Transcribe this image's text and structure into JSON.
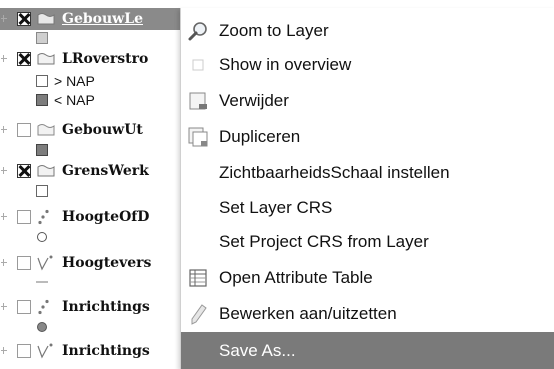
{
  "layer_tree": {
    "layers": [
      {
        "name": "GebouwLe",
        "checked": true,
        "icon": "polygon-layer-icon",
        "highlighted": true
      },
      {
        "name": "LRoverstro",
        "checked": true,
        "icon": "polygon-layer-icon"
      },
      {
        "name": "GebouwUt",
        "checked": false,
        "icon": "polygon-layer-icon"
      },
      {
        "name": "GrensWerk",
        "checked": true,
        "icon": "polygon-layer-icon"
      },
      {
        "name": "HoogteOfD",
        "checked": false,
        "icon": "point-layer-icon"
      },
      {
        "name": "Hoogtevers",
        "checked": false,
        "icon": "line-layer-icon"
      },
      {
        "name": "Inrichtings",
        "checked": false,
        "icon": "point-layer-icon"
      },
      {
        "name": "Inrichtings",
        "checked": false,
        "icon": "line-layer-icon"
      }
    ],
    "legend_labels": {
      "above_nap": "> NAP",
      "below_nap": "< NAP"
    }
  },
  "context_menu": {
    "items": [
      {
        "label": "Zoom to Layer",
        "icon": "zoom-icon"
      },
      {
        "label": "Show in overview",
        "icon": "checkbox-icon"
      },
      {
        "label": "Verwijder",
        "icon": "remove-layer-icon"
      },
      {
        "label": "Dupliceren",
        "icon": "duplicate-layer-icon"
      },
      {
        "label": "ZichtbaarheidsSchaal instellen",
        "icon": ""
      },
      {
        "label": "Set Layer CRS",
        "icon": ""
      },
      {
        "label": "Set Project CRS from Layer",
        "icon": ""
      },
      {
        "label": "Open Attribute Table",
        "icon": "table-icon"
      },
      {
        "label": "Bewerken aan/uitzetten",
        "icon": "pencil-icon"
      },
      {
        "label": "Save As...",
        "icon": "",
        "active": true
      }
    ]
  },
  "colors": {
    "highlight": "#8a8a8a",
    "menu_active": "#7a7a7a"
  }
}
